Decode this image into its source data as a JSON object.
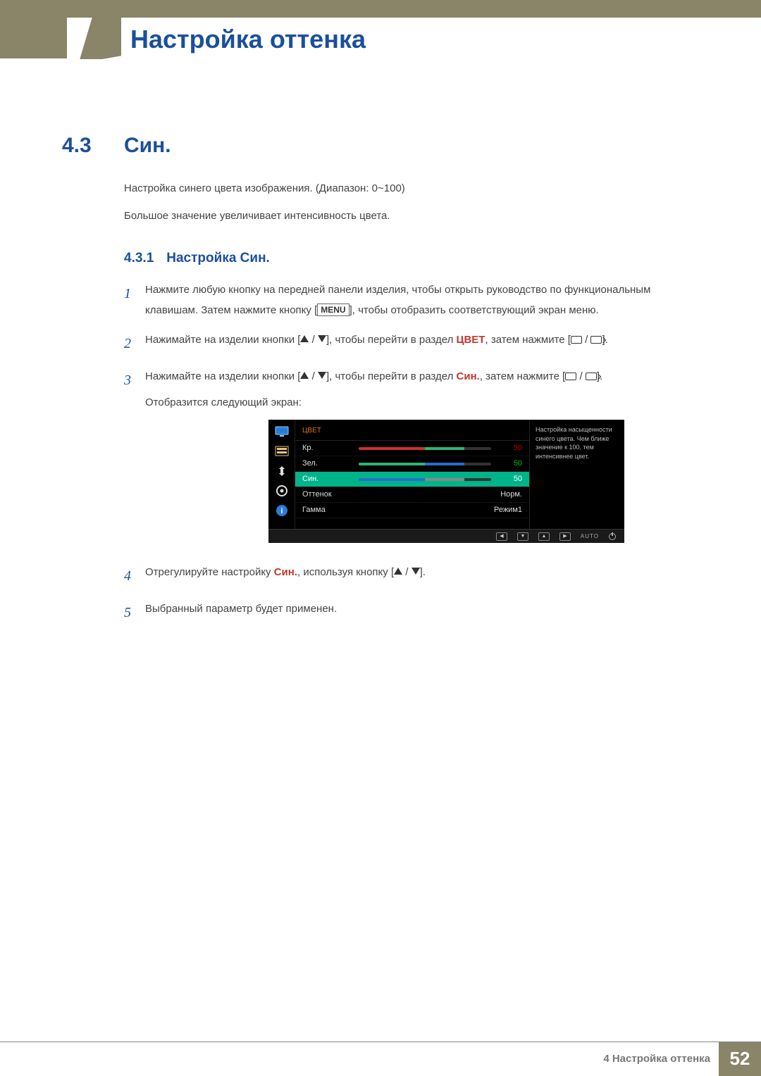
{
  "chapter_title": "Настройка оттенка",
  "section": {
    "num": "4.3",
    "title": "Син."
  },
  "intro": [
    "Настройка синего цвета изображения. (Диапазон: 0~100)",
    "Большое значение увеличивает интенсивность цвета."
  ],
  "subsection": {
    "num": "4.3.1",
    "title": "Настройка Син."
  },
  "steps": {
    "s1": {
      "num": "1",
      "pre": "Нажмите любую кнопку на передней панели изделия, чтобы открыть руководство по функциональным клавишам. Затем нажмите кнопку [",
      "menu": "MENU",
      "post": "], чтобы отобразить соответствующий экран меню."
    },
    "s2": {
      "num": "2",
      "pre": "Нажимайте на изделии кнопки [",
      "mid": "], чтобы перейти в раздел ",
      "hl": "ЦВЕТ",
      "post1": ", затем нажмите [",
      "post2": "]."
    },
    "s3": {
      "num": "3",
      "pre": "Нажимайте на изделии кнопки [",
      "mid": "], чтобы перейти в раздел ",
      "hl": "Син.",
      "post1": ", затем нажмите [",
      "post2": "].",
      "after": "Отобразится следующий экран:"
    },
    "s4": {
      "num": "4",
      "pre": "Отрегулируйте настройку ",
      "hl": "Син.",
      "mid": ", используя кнопку [",
      "post": "]."
    },
    "s5": {
      "num": "5",
      "text": "Выбранный параметр будет применен."
    }
  },
  "osd": {
    "header": "ЦВЕТ",
    "rows": {
      "r1": {
        "label": "Кр.",
        "value": "50",
        "fill_color": "#d03030",
        "half_color": "#2bb673",
        "fill_pct": 50
      },
      "r2": {
        "label": "Зел.",
        "value": "50",
        "fill_color": "#2bb673",
        "half_color": "#2a6bd0",
        "fill_pct": 50
      },
      "r3": {
        "label": "Син.",
        "value": "50",
        "fill_color": "#2a6bd0",
        "half_color": "#888888",
        "fill_pct": 50
      },
      "r4": {
        "label": "Оттенок",
        "value": "Норм."
      },
      "r5": {
        "label": "Гамма",
        "value": "Режим1"
      }
    },
    "help": "Настройка насыщенности синего цвета. Чем ближе значение к 100, тем интенсивнее цвет.",
    "footer_auto": "AUTO"
  },
  "footer": {
    "chapter_label": "4 Настройка оттенка",
    "page": "52"
  }
}
